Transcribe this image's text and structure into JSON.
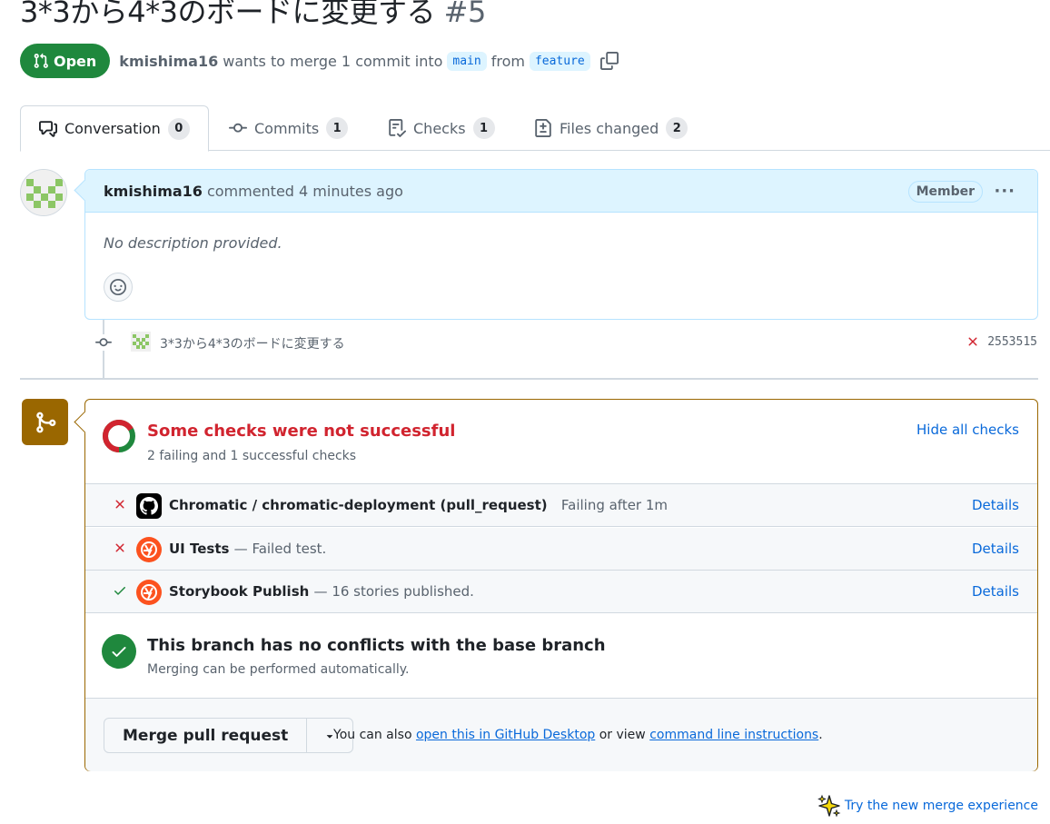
{
  "pr": {
    "title": "3*3から4*3のボードに変更する",
    "number": "#5",
    "state": "Open",
    "author": "kmishima16",
    "merge_text": "wants to merge 1 commit into",
    "base_branch": "main",
    "from_text": "from",
    "head_branch": "feature"
  },
  "tabs": [
    {
      "label": "Conversation",
      "count": "0",
      "icon": "comment-discussion-icon"
    },
    {
      "label": "Commits",
      "count": "1",
      "icon": "git-commit-icon"
    },
    {
      "label": "Checks",
      "count": "1",
      "icon": "checklist-icon"
    },
    {
      "label": "Files changed",
      "count": "2",
      "icon": "file-diff-icon"
    }
  ],
  "comment": {
    "author": "kmishima16",
    "action": "commented 4 minutes ago",
    "role": "Member",
    "more": "···",
    "body": "No description provided."
  },
  "commit": {
    "message": "3*3から4*3のボードに変更する",
    "sha": "2553515",
    "status": "failed"
  },
  "checks": {
    "title": "Some checks were not successful",
    "summary": "2 failing and 1 successful checks",
    "hide_label": "Hide all checks",
    "failing_fraction": 0.667,
    "rows": [
      {
        "name": "Chromatic / chromatic-deployment (pull_request)",
        "desc": "Failing after 1m",
        "details": "Details",
        "status": "failure",
        "icon": "github-icon"
      },
      {
        "name": "UI Tests",
        "desc": "— Failed test.",
        "details": "Details",
        "status": "failure",
        "icon": "chromatic-icon"
      },
      {
        "name": "Storybook Publish",
        "desc": "— 16 stories published.",
        "details": "Details",
        "status": "success",
        "icon": "chromatic-icon"
      }
    ]
  },
  "conflicts": {
    "title": "This branch has no conflicts with the base branch",
    "subtitle": "Merging can be performed automatically."
  },
  "merge": {
    "button_label": "Merge pull request",
    "note_prefix": "You can also",
    "desktop_link": "open this in GitHub Desktop",
    "note_middle": "or view",
    "cli_link": "command line instructions",
    "note_suffix": "."
  },
  "try_new": "Try the new merge experience",
  "colors": {
    "open_green": "#1f883d",
    "fail_red": "#d1242f",
    "link_blue": "#0969da",
    "merge_brown": "#9a6700"
  }
}
